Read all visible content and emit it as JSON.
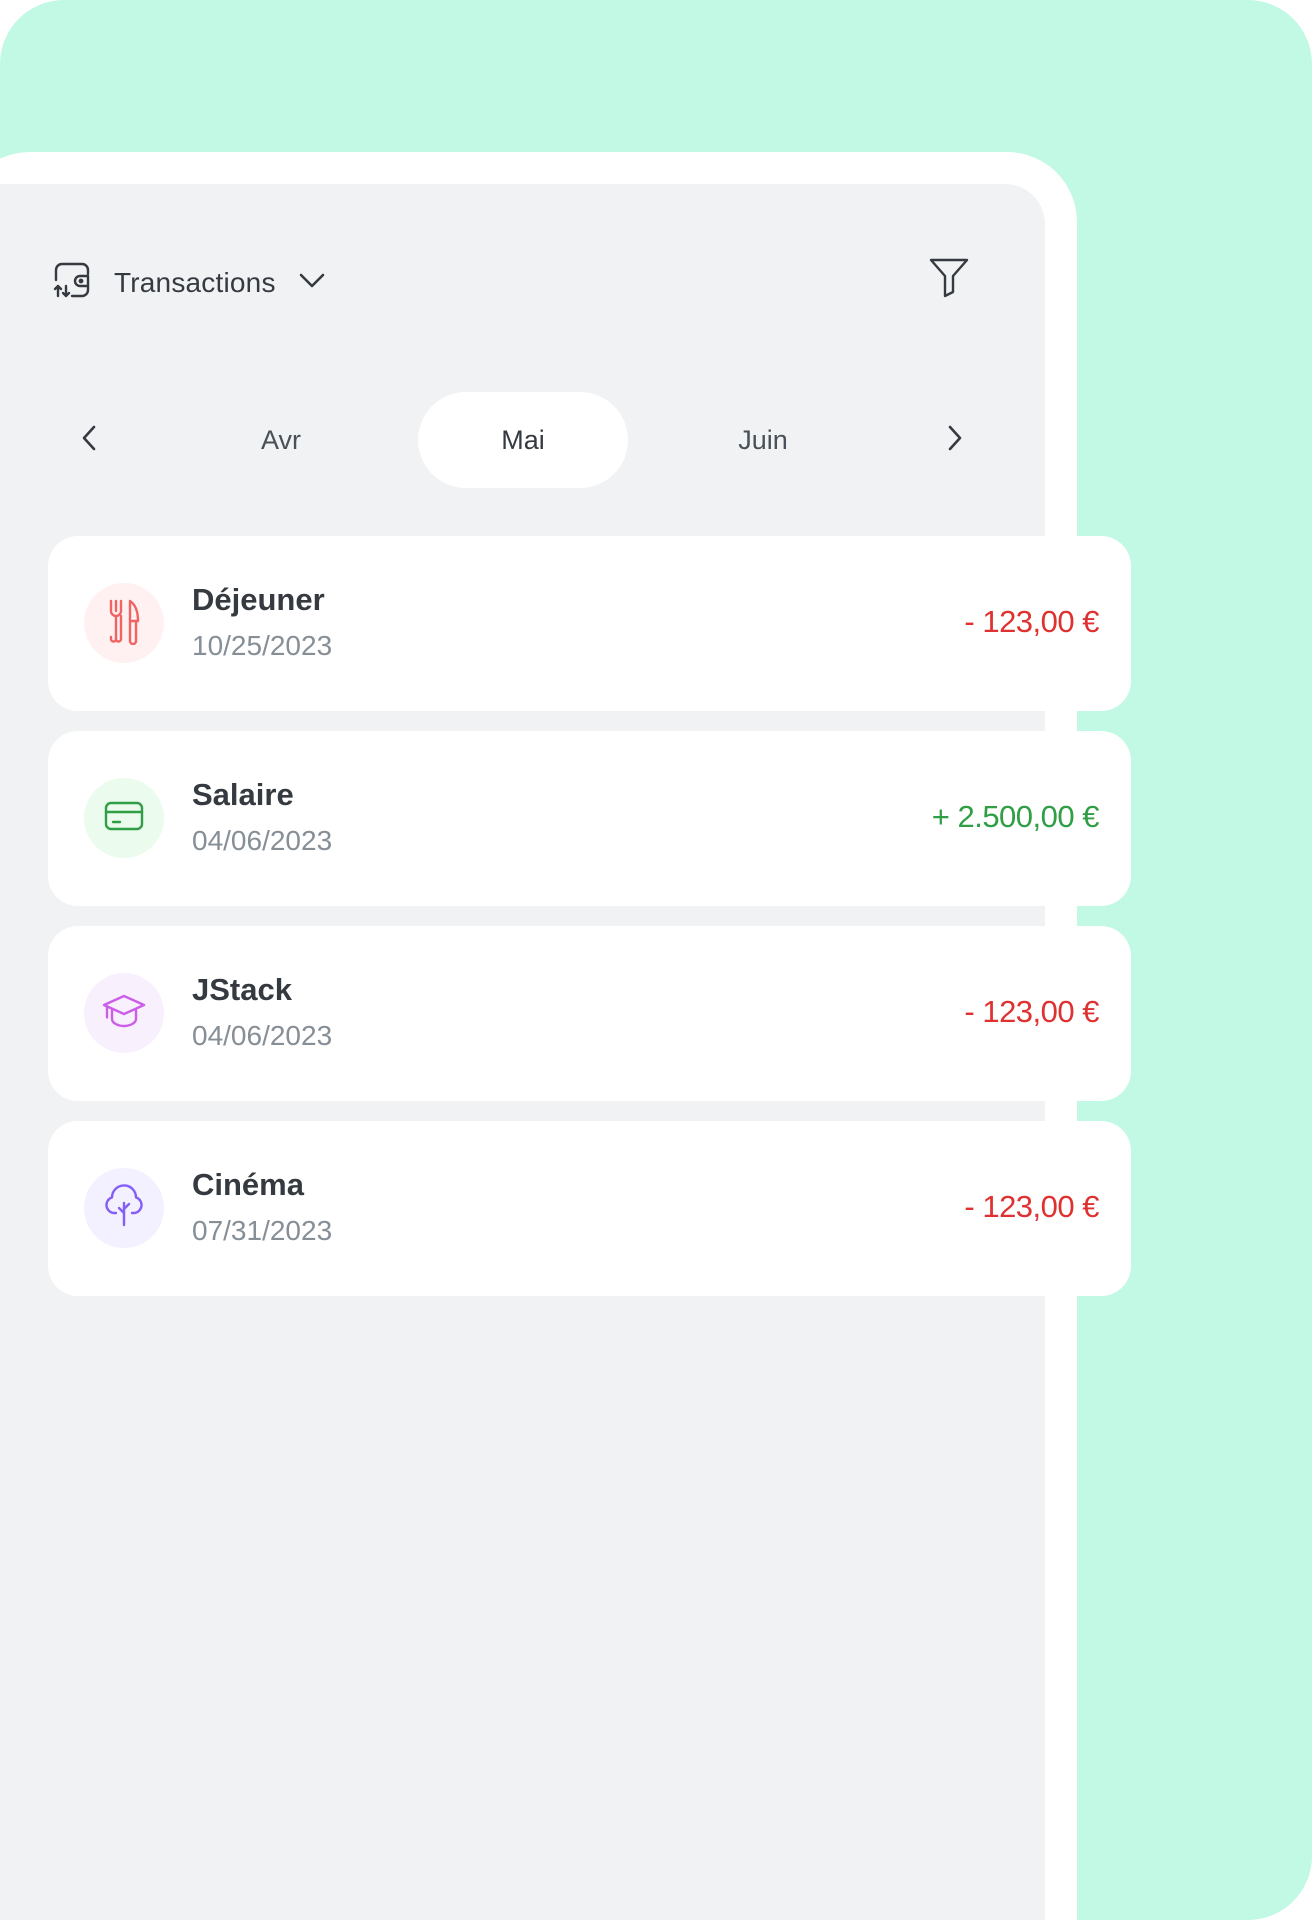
{
  "header": {
    "title": "Transactions",
    "icon": "transactions-icon",
    "dropdown_icon": "chevron-down-icon",
    "filter_icon": "filter-icon"
  },
  "months": {
    "prev_icon": "chevron-left-icon",
    "next_icon": "chevron-right-icon",
    "items": [
      "Avr",
      "Mai",
      "Juin"
    ],
    "selected": "Mai"
  },
  "colors": {
    "mint": "#c2f9e4",
    "panel": "#f1f2f4",
    "expense": "#e03131",
    "income": "#2f9e44"
  },
  "transactions": [
    {
      "name": "Déjeuner",
      "date": "10/25/2023",
      "amount": "- 123,00 €",
      "type": "expense",
      "icon": "fork-knife-icon",
      "icon_bg": "#fff1f1",
      "icon_color": "#f06464"
    },
    {
      "name": "Salaire",
      "date": "04/06/2023",
      "amount": "+ 2.500,00 €",
      "type": "income",
      "icon": "credit-card-icon",
      "icon_bg": "#ebfbee",
      "icon_color": "#2f9e44"
    },
    {
      "name": "JStack",
      "date": "04/06/2023",
      "amount": "- 123,00 €",
      "type": "expense",
      "icon": "graduation-cap-icon",
      "icon_bg": "#f8f0fc",
      "icon_color": "#cc5de8"
    },
    {
      "name": "Cinéma",
      "date": "07/31/2023",
      "amount": "- 123,00 €",
      "type": "expense",
      "icon": "tree-icon",
      "icon_bg": "#f3f0ff",
      "icon_color": "#845ef7"
    }
  ]
}
